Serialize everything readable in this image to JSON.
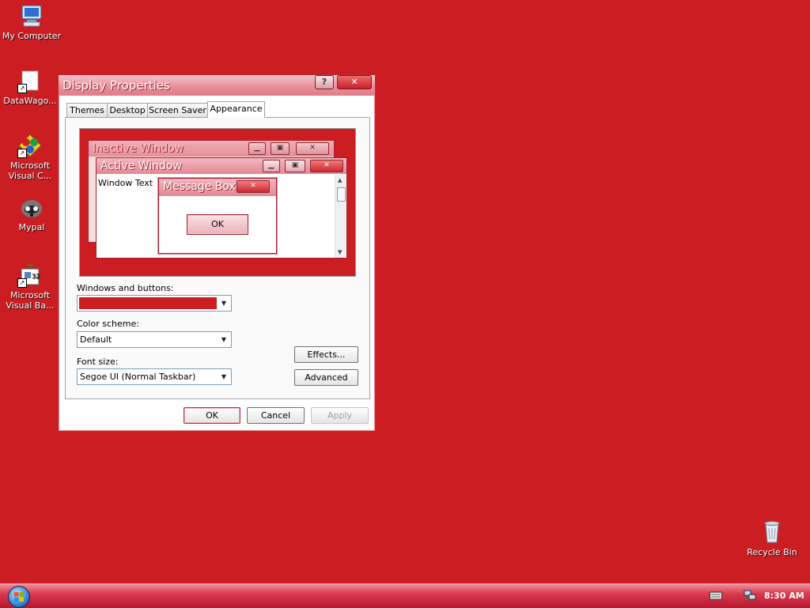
{
  "desktop": {
    "icons": [
      {
        "label": "My Computer",
        "icon": "computer-icon"
      },
      {
        "label": "DataWago...",
        "icon": "shortcut-icon"
      },
      {
        "label": "Microsoft Visual C...",
        "icon": "visual-c-icon"
      },
      {
        "label": "Mypal",
        "icon": "mypal-icon"
      },
      {
        "label": "Microsoft Visual Ba...",
        "icon": "visual-basic-icon"
      }
    ],
    "recycle_bin": "Recycle Bin",
    "background_color": "#cc1e22"
  },
  "dialog": {
    "title": "Display Properties",
    "help_label": "?",
    "close_label": "✕",
    "tabs": [
      {
        "label": "Themes"
      },
      {
        "label": "Desktop"
      },
      {
        "label": "Screen Saver"
      },
      {
        "label": "Appearance",
        "active": true
      }
    ],
    "preview": {
      "inactive_title": "Inactive Window",
      "active_title": "Active Window",
      "window_text": "Window Text",
      "message_title": "Message Box",
      "ok_label": "OK"
    },
    "windows_and_buttons_label": "Windows and buttons:",
    "windows_and_buttons_value": "",
    "color_scheme_label": "Color scheme:",
    "color_scheme_value": "Default",
    "font_size_label": "Font size:",
    "font_size_value": "Segoe UI (Normal Taskbar)",
    "effects_label": "Effects...",
    "advanced_label": "Advanced",
    "ok_label": "OK",
    "cancel_label": "Cancel",
    "apply_label": "Apply"
  },
  "taskbar": {
    "clock": "8:30 AM"
  },
  "colors": {
    "accent": "#cc1e22",
    "title_gradient": "#e8909b"
  }
}
